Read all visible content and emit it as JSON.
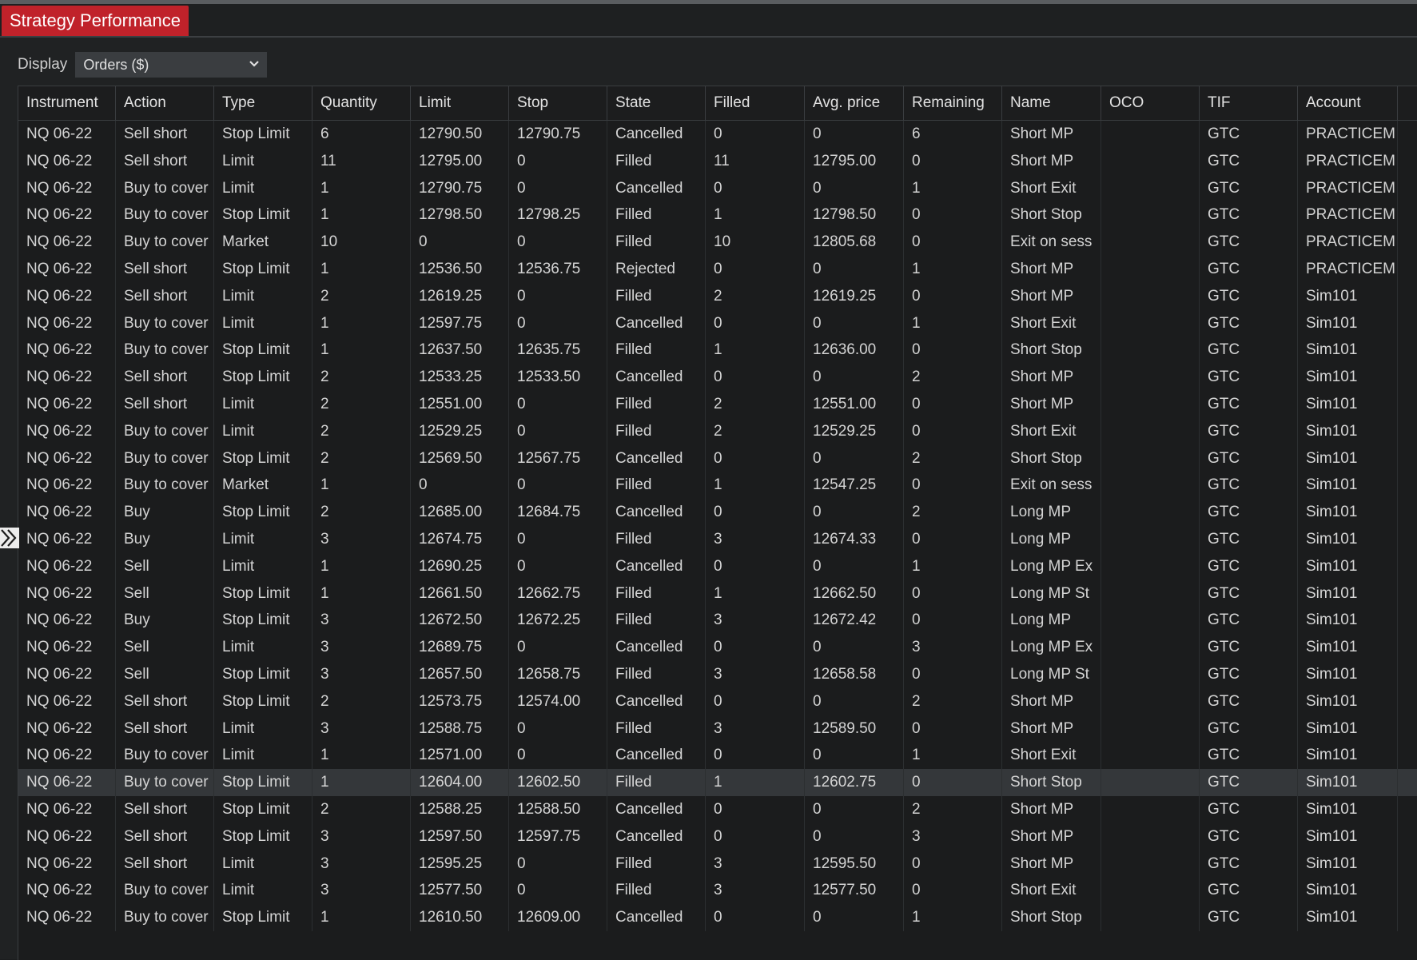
{
  "window": {
    "tab_title": "Strategy Performance"
  },
  "display": {
    "label": "Display",
    "selected": "Orders ($)"
  },
  "columns": [
    "Instrument",
    "Action",
    "Type",
    "Quantity",
    "Limit",
    "Stop",
    "State",
    "Filled",
    "Avg. price",
    "Remaining",
    "Name",
    "OCO",
    "TIF",
    "Account"
  ],
  "rows": [
    [
      "NQ 06-22",
      "Sell short",
      "Stop Limit",
      "6",
      "12790.50",
      "12790.75",
      "Cancelled",
      "0",
      "0",
      "6",
      "Short MP",
      "",
      "GTC",
      "PRACTICEM"
    ],
    [
      "NQ 06-22",
      "Sell short",
      "Limit",
      "11",
      "12795.00",
      "0",
      "Filled",
      "11",
      "12795.00",
      "0",
      "Short MP",
      "",
      "GTC",
      "PRACTICEM"
    ],
    [
      "NQ 06-22",
      "Buy to cover",
      "Limit",
      "1",
      "12790.75",
      "0",
      "Cancelled",
      "0",
      "0",
      "1",
      "Short Exit",
      "",
      "GTC",
      "PRACTICEM"
    ],
    [
      "NQ 06-22",
      "Buy to cover",
      "Stop Limit",
      "1",
      "12798.50",
      "12798.25",
      "Filled",
      "1",
      "12798.50",
      "0",
      "Short Stop",
      "",
      "GTC",
      "PRACTICEM"
    ],
    [
      "NQ 06-22",
      "Buy to cover",
      "Market",
      "10",
      "0",
      "0",
      "Filled",
      "10",
      "12805.68",
      "0",
      "Exit on sess",
      "",
      "GTC",
      "PRACTICEM"
    ],
    [
      "NQ 06-22",
      "Sell short",
      "Stop Limit",
      "1",
      "12536.50",
      "12536.75",
      "Rejected",
      "0",
      "0",
      "1",
      "Short MP",
      "",
      "GTC",
      "PRACTICEM"
    ],
    [
      "NQ 06-22",
      "Sell short",
      "Limit",
      "2",
      "12619.25",
      "0",
      "Filled",
      "2",
      "12619.25",
      "0",
      "Short MP",
      "",
      "GTC",
      "Sim101"
    ],
    [
      "NQ 06-22",
      "Buy to cover",
      "Limit",
      "1",
      "12597.75",
      "0",
      "Cancelled",
      "0",
      "0",
      "1",
      "Short Exit",
      "",
      "GTC",
      "Sim101"
    ],
    [
      "NQ 06-22",
      "Buy to cover",
      "Stop Limit",
      "1",
      "12637.50",
      "12635.75",
      "Filled",
      "1",
      "12636.00",
      "0",
      "Short Stop",
      "",
      "GTC",
      "Sim101"
    ],
    [
      "NQ 06-22",
      "Sell short",
      "Stop Limit",
      "2",
      "12533.25",
      "12533.50",
      "Cancelled",
      "0",
      "0",
      "2",
      "Short MP",
      "",
      "GTC",
      "Sim101"
    ],
    [
      "NQ 06-22",
      "Sell short",
      "Limit",
      "2",
      "12551.00",
      "0",
      "Filled",
      "2",
      "12551.00",
      "0",
      "Short MP",
      "",
      "GTC",
      "Sim101"
    ],
    [
      "NQ 06-22",
      "Buy to cover",
      "Limit",
      "2",
      "12529.25",
      "0",
      "Filled",
      "2",
      "12529.25",
      "0",
      "Short Exit",
      "",
      "GTC",
      "Sim101"
    ],
    [
      "NQ 06-22",
      "Buy to cover",
      "Stop Limit",
      "2",
      "12569.50",
      "12567.75",
      "Cancelled",
      "0",
      "0",
      "2",
      "Short Stop",
      "",
      "GTC",
      "Sim101"
    ],
    [
      "NQ 06-22",
      "Buy to cover",
      "Market",
      "1",
      "0",
      "0",
      "Filled",
      "1",
      "12547.25",
      "0",
      "Exit on sess",
      "",
      "GTC",
      "Sim101"
    ],
    [
      "NQ 06-22",
      "Buy",
      "Stop Limit",
      "2",
      "12685.00",
      "12684.75",
      "Cancelled",
      "0",
      "0",
      "2",
      "Long MP",
      "",
      "GTC",
      "Sim101"
    ],
    [
      "NQ 06-22",
      "Buy",
      "Limit",
      "3",
      "12674.75",
      "0",
      "Filled",
      "3",
      "12674.33",
      "0",
      "Long MP",
      "",
      "GTC",
      "Sim101"
    ],
    [
      "NQ 06-22",
      "Sell",
      "Limit",
      "1",
      "12690.25",
      "0",
      "Cancelled",
      "0",
      "0",
      "1",
      "Long MP Ex",
      "",
      "GTC",
      "Sim101"
    ],
    [
      "NQ 06-22",
      "Sell",
      "Stop Limit",
      "1",
      "12661.50",
      "12662.75",
      "Filled",
      "1",
      "12662.50",
      "0",
      "Long MP St",
      "",
      "GTC",
      "Sim101"
    ],
    [
      "NQ 06-22",
      "Buy",
      "Stop Limit",
      "3",
      "12672.50",
      "12672.25",
      "Filled",
      "3",
      "12672.42",
      "0",
      "Long MP",
      "",
      "GTC",
      "Sim101"
    ],
    [
      "NQ 06-22",
      "Sell",
      "Limit",
      "3",
      "12689.75",
      "0",
      "Cancelled",
      "0",
      "0",
      "3",
      "Long MP Ex",
      "",
      "GTC",
      "Sim101"
    ],
    [
      "NQ 06-22",
      "Sell",
      "Stop Limit",
      "3",
      "12657.50",
      "12658.75",
      "Filled",
      "3",
      "12658.58",
      "0",
      "Long MP St",
      "",
      "GTC",
      "Sim101"
    ],
    [
      "NQ 06-22",
      "Sell short",
      "Stop Limit",
      "2",
      "12573.75",
      "12574.00",
      "Cancelled",
      "0",
      "0",
      "2",
      "Short MP",
      "",
      "GTC",
      "Sim101"
    ],
    [
      "NQ 06-22",
      "Sell short",
      "Limit",
      "3",
      "12588.75",
      "0",
      "Filled",
      "3",
      "12589.50",
      "0",
      "Short MP",
      "",
      "GTC",
      "Sim101"
    ],
    [
      "NQ 06-22",
      "Buy to cover",
      "Limit",
      "1",
      "12571.00",
      "0",
      "Cancelled",
      "0",
      "0",
      "1",
      "Short Exit",
      "",
      "GTC",
      "Sim101"
    ],
    [
      "NQ 06-22",
      "Buy to cover",
      "Stop Limit",
      "1",
      "12604.00",
      "12602.50",
      "Filled",
      "1",
      "12602.75",
      "0",
      "Short Stop",
      "",
      "GTC",
      "Sim101"
    ],
    [
      "NQ 06-22",
      "Sell short",
      "Stop Limit",
      "2",
      "12588.25",
      "12588.50",
      "Cancelled",
      "0",
      "0",
      "2",
      "Short MP",
      "",
      "GTC",
      "Sim101"
    ],
    [
      "NQ 06-22",
      "Sell short",
      "Stop Limit",
      "3",
      "12597.50",
      "12597.75",
      "Cancelled",
      "0",
      "0",
      "3",
      "Short MP",
      "",
      "GTC",
      "Sim101"
    ],
    [
      "NQ 06-22",
      "Sell short",
      "Limit",
      "3",
      "12595.25",
      "0",
      "Filled",
      "3",
      "12595.50",
      "0",
      "Short MP",
      "",
      "GTC",
      "Sim101"
    ],
    [
      "NQ 06-22",
      "Buy to cover",
      "Limit",
      "3",
      "12577.50",
      "0",
      "Filled",
      "3",
      "12577.50",
      "0",
      "Short Exit",
      "",
      "GTC",
      "Sim101"
    ],
    [
      "NQ 06-22",
      "Buy to cover",
      "Stop Limit",
      "1",
      "12610.50",
      "12609.00",
      "Cancelled",
      "0",
      "0",
      "1",
      "Short Stop",
      "",
      "GTC",
      "Sim101"
    ]
  ],
  "selected_row_index": 24,
  "icons": {
    "dropdown": "chevron-down-icon",
    "row_marker": "row-expand-icon"
  },
  "colors": {
    "tab_active": "#c0222a",
    "background": "#1b1d1e",
    "row_selected": "#34373a"
  }
}
